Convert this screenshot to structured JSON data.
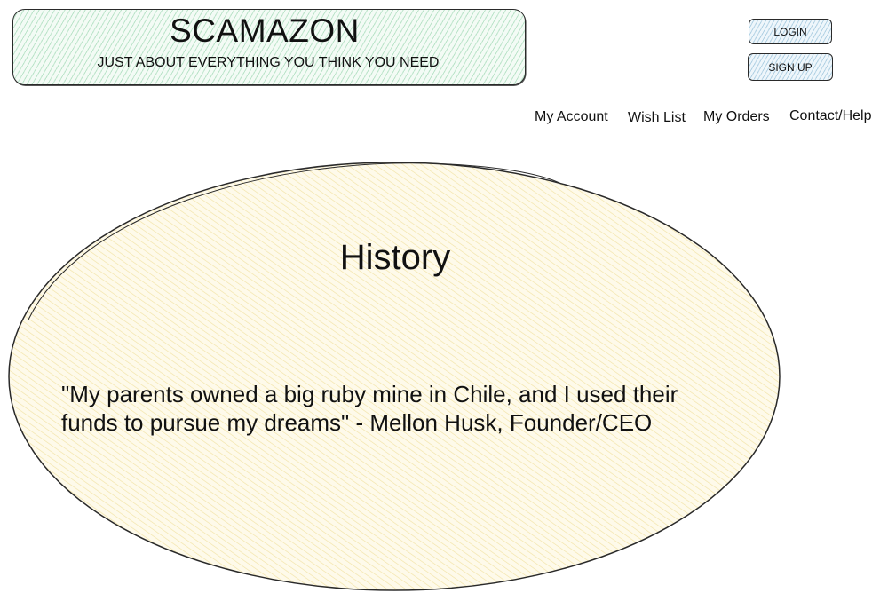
{
  "header": {
    "brand_name": "SCAMAZON",
    "tagline": "JUST ABOUT EVERYTHING YOU THINK YOU NEED"
  },
  "auth": {
    "login_label": "LOGIN",
    "signup_label": "SIGN UP"
  },
  "nav": {
    "items": [
      {
        "label": "My Account"
      },
      {
        "label": "Wish List"
      },
      {
        "label": "My Orders"
      },
      {
        "label": "Contact/Help"
      }
    ]
  },
  "main": {
    "heading": "History",
    "quote": "\"My parents owned a big ruby mine in Chile, and I used their funds to pursue my dreams\" - Mellon Husk, Founder/CEO"
  },
  "colors": {
    "banner_fill": "#e6f7ec",
    "button_fill": "#dcecf5",
    "ellipse_fill": "#fdf6d8",
    "stroke": "#2a2a2a"
  }
}
